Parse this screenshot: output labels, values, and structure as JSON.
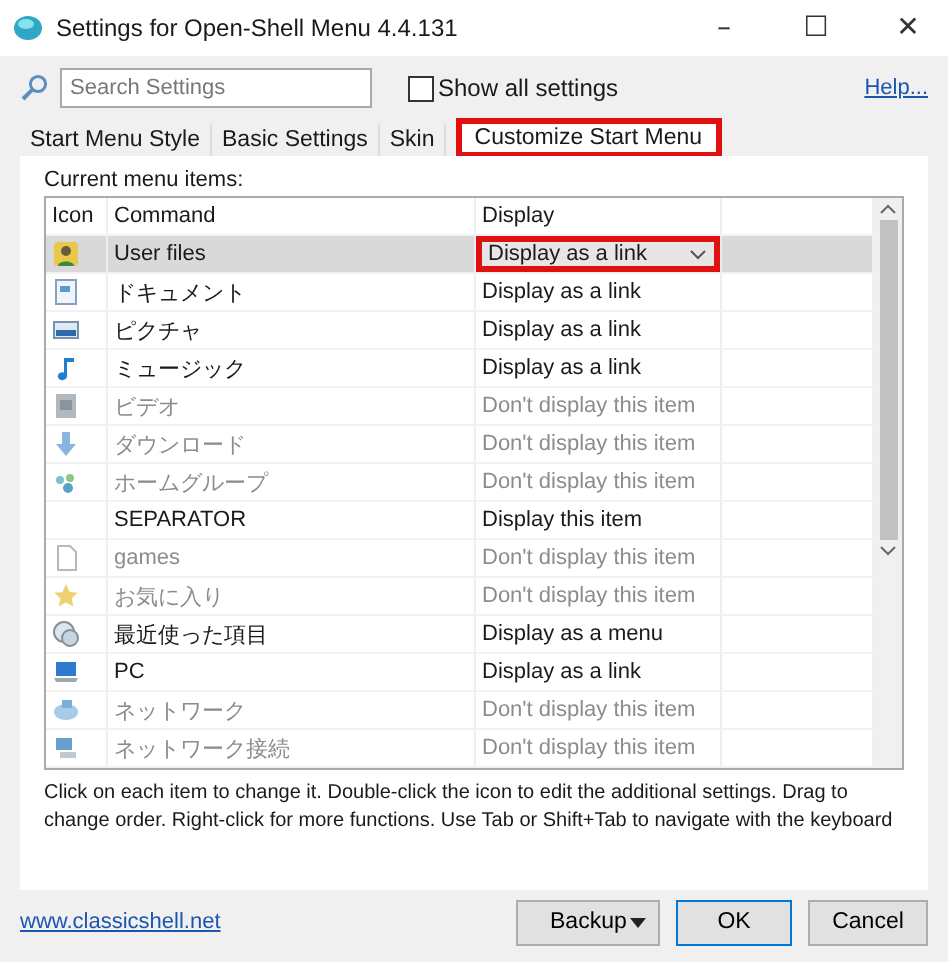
{
  "window": {
    "title": "Settings for Open-Shell Menu 4.4.131",
    "controls": [
      "–",
      "☐",
      "✕"
    ]
  },
  "search": {
    "placeholder": "Search Settings"
  },
  "show_all": {
    "label": "Show all settings",
    "checked": false
  },
  "help_link": "Help...",
  "tabs": [
    {
      "label": "Start Menu Style",
      "selected": false,
      "highlighted": false
    },
    {
      "label": "Basic Settings",
      "selected": false,
      "highlighted": false
    },
    {
      "label": "Skin",
      "selected": false,
      "highlighted": false
    },
    {
      "label": "Customize Start Menu",
      "selected": true,
      "highlighted": true
    }
  ],
  "list_caption": "Current menu items:",
  "table": {
    "columns": [
      "Icon",
      "Command",
      "Display"
    ],
    "rows": [
      {
        "command": "User files",
        "display": "Display as a link",
        "disabled": false,
        "selected": true,
        "highlighted": true
      },
      {
        "command": "ドキュメント",
        "display": "Display as a link",
        "disabled": false,
        "selected": false,
        "highlighted": false
      },
      {
        "command": "ピクチャ",
        "display": "Display as a link",
        "disabled": false,
        "selected": false,
        "highlighted": false
      },
      {
        "command": "ミュージック",
        "display": "Display as a link",
        "disabled": false,
        "selected": false,
        "highlighted": false
      },
      {
        "command": "ビデオ",
        "display": "Don't display this item",
        "disabled": true,
        "selected": false,
        "highlighted": false
      },
      {
        "command": "ダウンロード",
        "display": "Don't display this item",
        "disabled": true,
        "selected": false,
        "highlighted": false
      },
      {
        "command": "ホームグループ",
        "display": "Don't display this item",
        "disabled": true,
        "selected": false,
        "highlighted": false
      },
      {
        "command": "SEPARATOR",
        "display": "Display this item",
        "disabled": false,
        "selected": false,
        "highlighted": false
      },
      {
        "command": "games",
        "display": "Don't display this item",
        "disabled": true,
        "selected": false,
        "highlighted": false
      },
      {
        "command": "お気に入り",
        "display": "Don't display this item",
        "disabled": true,
        "selected": false,
        "highlighted": false
      },
      {
        "command": "最近使った項目",
        "display": "Display as a menu",
        "disabled": false,
        "selected": false,
        "highlighted": false
      },
      {
        "command": "PC",
        "display": "Display as a link",
        "disabled": false,
        "selected": false,
        "highlighted": false
      },
      {
        "command": "ネットワーク",
        "display": "Don't display this item",
        "disabled": true,
        "selected": false,
        "highlighted": false
      },
      {
        "command": "ネットワーク接続",
        "display": "Don't display this item",
        "disabled": true,
        "selected": false,
        "highlighted": false
      }
    ]
  },
  "hint": "Click on each item to change it. Double-click the icon to edit the additional settings. Drag to change order. Right-click for more functions. Use Tab or Shift+Tab to navigate with the keyboard",
  "footer": {
    "link": "www.classicshell.net",
    "buttons": [
      {
        "label": "Backup",
        "kind": "split"
      },
      {
        "label": "OK",
        "kind": "default"
      },
      {
        "label": "Cancel",
        "kind": "plain"
      }
    ]
  }
}
